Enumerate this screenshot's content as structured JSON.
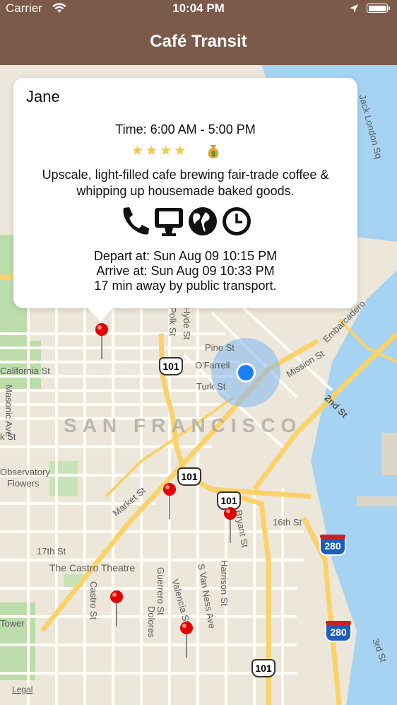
{
  "status_bar": {
    "carrier": "Carrier",
    "time": "10:04 PM"
  },
  "nav": {
    "title": "Café Transit"
  },
  "map": {
    "city_label": "SAN FRANCISCO",
    "legal": "Legal",
    "street_labels": {
      "pine": "Pine St",
      "ofarrell": "O'Farrell",
      "turk": "Turk St",
      "california": "California St",
      "masonic": "Masonic Ave",
      "market": "Market St",
      "17th": "17th St",
      "16th": "16th St",
      "castro": "Castro St",
      "guerrero": "Guerrero St",
      "valencia": "Valencia St",
      "dolores": "Dolores",
      "svanness": "S Van Ness Ave",
      "harrison": "Harrison St",
      "bryant": "Bryant St",
      "mission": "Mission St",
      "second": "2nd St",
      "third": "3rd St",
      "embarcadero": "Embarcadero",
      "polk": "Polk St",
      "hyde": "Hyde St",
      "castro_theatre": "The Castro Theatre",
      "observatory": "Observatory",
      "flowers": "Flowers",
      "tower": "Tower",
      "jack_london": "Jack London Sq",
      "k_st": "k St"
    },
    "shields": {
      "us101": "101",
      "i280": "280"
    }
  },
  "callout": {
    "name": "Jane",
    "hours": "Time: 6:00 AM - 5:00 PM",
    "rating_stars": 4,
    "rating_text": "★★★★",
    "price_icon": "money-bag-icon",
    "description": "Upscale, light-filled cafe brewing fair-trade coffee & whipping up housemade baked goods.",
    "amenity_icons": [
      "phone-icon",
      "computer-icon",
      "globe-icon",
      "clock-icon"
    ],
    "depart": "Depart at: Sun Aug 09 10:15 PM",
    "arrive": "Arrive at: Sun Aug 09 10:33 PM",
    "eta": "17 min away by public transport."
  },
  "colors": {
    "nav_bg": "#7b5a4a",
    "water": "#a6d3f2",
    "user_location": "#1a7ff0",
    "pin": "#e30000"
  }
}
